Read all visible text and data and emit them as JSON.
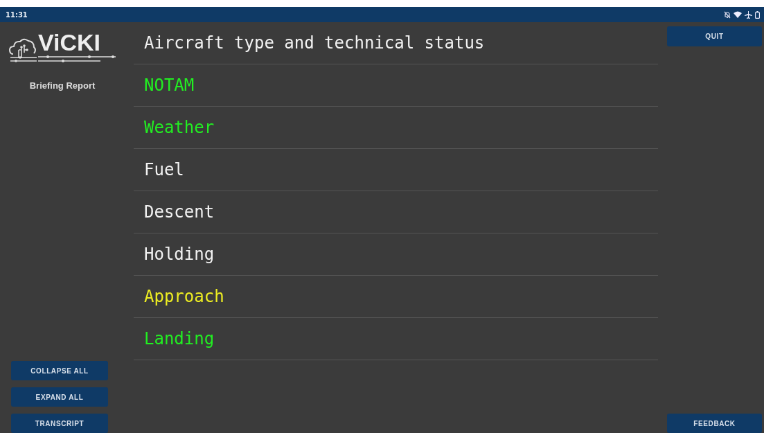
{
  "status_bar": {
    "time": "11:31"
  },
  "sidebar": {
    "logo_text": "ViCKI",
    "subtitle": "Briefing Report",
    "buttons": [
      "COLLAPSE ALL",
      "EXPAND ALL",
      "TRANSCRIPT"
    ]
  },
  "header": "Aircraft type and technical status",
  "sections": [
    {
      "label": "NOTAM",
      "color": "#22ee22"
    },
    {
      "label": "Weather",
      "color": "#22ee22"
    },
    {
      "label": "Fuel",
      "color": "#f2f2f2"
    },
    {
      "label": "Descent",
      "color": "#f2f2f2"
    },
    {
      "label": "Holding",
      "color": "#f2f2f2"
    },
    {
      "label": "Approach",
      "color": "#eeee22"
    },
    {
      "label": "Landing",
      "color": "#22ee22"
    }
  ],
  "right_buttons": {
    "top": "QUIT",
    "bottom": "FEEDBACK"
  }
}
